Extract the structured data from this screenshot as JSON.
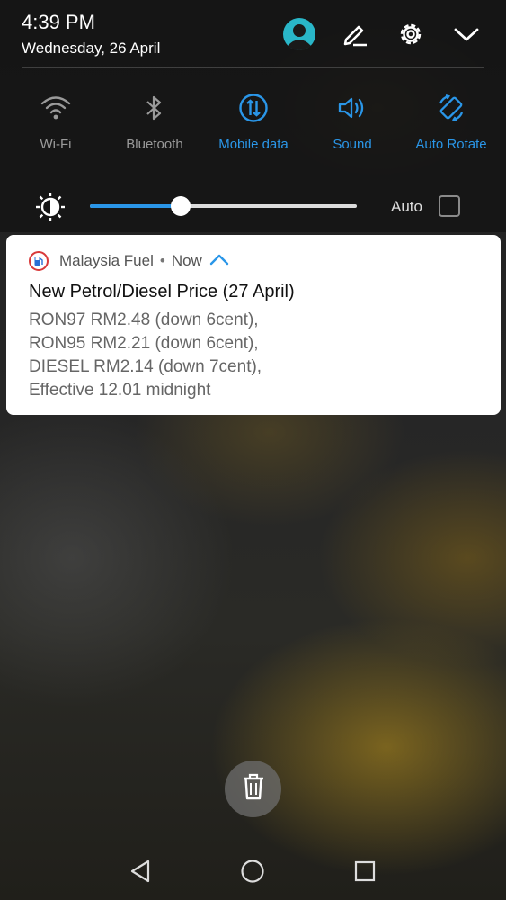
{
  "status": {
    "time": "4:39 PM",
    "date": "Wednesday, 26 April"
  },
  "header_icons": [
    "avatar-icon",
    "edit-icon",
    "settings-icon",
    "collapse-icon"
  ],
  "colors": {
    "accent": "#2a96e8",
    "inactive": "#9a9a9a",
    "avatar": "#29b6c8",
    "fuel_red": "#d93a3a",
    "fuel_blue": "#2a6fd4"
  },
  "quick_settings": [
    {
      "label": "Wi-Fi",
      "icon": "wifi-icon",
      "active": false
    },
    {
      "label": "Bluetooth",
      "icon": "bluetooth-icon",
      "active": false
    },
    {
      "label": "Mobile data",
      "icon": "mobile-data-icon",
      "active": true
    },
    {
      "label": "Sound",
      "icon": "sound-icon",
      "active": true
    },
    {
      "label": "Auto Rotate",
      "icon": "auto-rotate-icon",
      "active": true
    }
  ],
  "brightness": {
    "level": 0.34,
    "auto_label": "Auto",
    "auto_checked": false
  },
  "notification": {
    "app_name": "Malaysia Fuel",
    "separator": "•",
    "time": "Now",
    "title": "New Petrol/Diesel Price (27 April)",
    "lines": [
      "RON97 RM2.48 (down 6cent),",
      "RON95 RM2.21 (down 6cent),",
      "DIESEL RM2.14 (down 7cent),",
      "Effective 12.01 midnight"
    ]
  },
  "bottom": {
    "clear_icon": "trash-icon",
    "nav": [
      "back-icon",
      "home-icon",
      "recents-icon"
    ]
  }
}
